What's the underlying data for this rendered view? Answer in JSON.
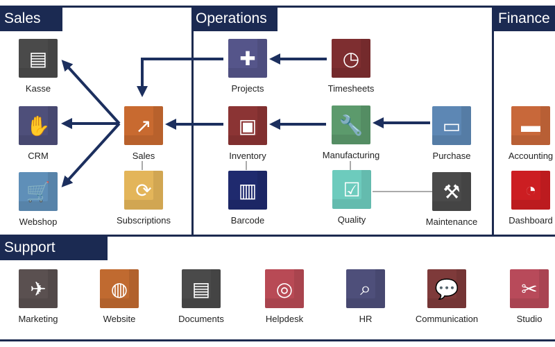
{
  "sections": {
    "sales": "Sales",
    "operations": "Operations",
    "finance": "Finance",
    "support": "Support"
  },
  "apps": {
    "kasse": {
      "label": "Kasse",
      "icon": "store-icon",
      "color": "#4a4a4a",
      "glyph": "▤"
    },
    "crm": {
      "label": "CRM",
      "icon": "handshake-icon",
      "color": "#4e4f7a",
      "glyph": "✋"
    },
    "webshop": {
      "label": "Webshop",
      "icon": "cart-icon",
      "color": "#5f8fb8",
      "glyph": "🛒"
    },
    "sales": {
      "label": "Sales",
      "icon": "chart-up-icon",
      "color": "#c86a30",
      "glyph": "↗"
    },
    "subscriptions": {
      "label": "Subscriptions",
      "icon": "recurring-icon",
      "color": "#e3b55a",
      "glyph": "⟳"
    },
    "projects": {
      "label": "Projects",
      "icon": "puzzle-icon",
      "color": "#55558a",
      "glyph": "✚"
    },
    "inventory": {
      "label": "Inventory",
      "icon": "box-icon",
      "color": "#8b3434",
      "glyph": "▣"
    },
    "barcode": {
      "label": "Barcode",
      "icon": "barcode-icon",
      "color": "#1f2a6e",
      "glyph": "▥"
    },
    "timesheets": {
      "label": "Timesheets",
      "icon": "stopwatch-icon",
      "color": "#7e2e30",
      "glyph": "◷"
    },
    "manufacturing": {
      "label": "Manufacturing",
      "icon": "wrench-icon",
      "color": "#5c9a6c",
      "glyph": "🔧"
    },
    "quality": {
      "label": "Quality",
      "icon": "quality-check-icon",
      "color": "#6dcbbd",
      "glyph": "☑"
    },
    "purchase": {
      "label": "Purchase",
      "icon": "credit-card-icon",
      "color": "#5d87b4",
      "glyph": "▭"
    },
    "maintenance": {
      "label": "Maintenance",
      "icon": "hammer-icon",
      "color": "#4a4a4a",
      "glyph": "⚒"
    },
    "accounting": {
      "label": "Accounting",
      "icon": "wallet-icon",
      "color": "#c8683a",
      "glyph": "▬"
    },
    "dashboard": {
      "label": "Dashboard",
      "icon": "gauge-icon",
      "color": "#cc1e22",
      "glyph": "◔"
    },
    "marketing": {
      "label": "Marketing",
      "icon": "paper-plane-icon",
      "color": "#5a5050",
      "glyph": "✈"
    },
    "website": {
      "label": "Website",
      "icon": "globe-icon",
      "color": "#c06a30",
      "glyph": "◍"
    },
    "documents": {
      "label": "Documents",
      "icon": "inbox-icon",
      "color": "#4a4a4a",
      "glyph": "▤"
    },
    "helpdesk": {
      "label": "Helpdesk",
      "icon": "lifebuoy-icon",
      "color": "#b84a55",
      "glyph": "◎"
    },
    "hr": {
      "label": "HR",
      "icon": "magnifier-icon",
      "color": "#4e4f7a",
      "glyph": "⌕"
    },
    "communication": {
      "label": "Communication",
      "icon": "chat-bubble-icon",
      "color": "#7e3a3a",
      "glyph": "💬"
    },
    "studio": {
      "label": "Studio",
      "icon": "tools-icon",
      "color": "#b84a5a",
      "glyph": "✂"
    }
  },
  "colors": {
    "navy": "#1c2f5e"
  }
}
